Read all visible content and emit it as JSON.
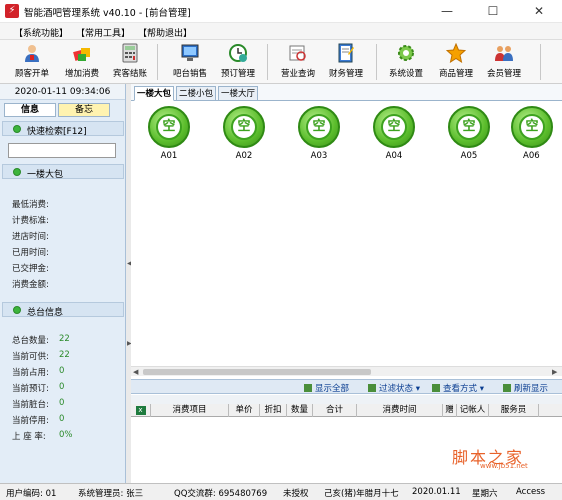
{
  "window": {
    "title": "智能酒吧管理系统 v40.10 - [前台管理]",
    "minimize": "—",
    "maximize": "☐",
    "close": "✕"
  },
  "menu": [
    {
      "label": "【系统功能】"
    },
    {
      "label": "【常用工具】"
    },
    {
      "label": "【帮助退出】"
    }
  ],
  "toolbar": [
    {
      "label": "顾客开单",
      "icon": "customer-icon"
    },
    {
      "label": "增加消费",
      "icon": "add-consume-icon"
    },
    {
      "label": "宾客结账",
      "icon": "calculator-icon"
    },
    {
      "label": "吧台销售",
      "icon": "monitor-icon"
    },
    {
      "label": "预订管理",
      "icon": "clock-icon"
    },
    {
      "label": "营业查询",
      "icon": "magnifier-icon"
    },
    {
      "label": "财务管理",
      "icon": "notebook-icon"
    },
    {
      "label": "系统设置",
      "icon": "gear-icon"
    },
    {
      "label": "商品管理",
      "icon": "star-icon"
    },
    {
      "label": "会员管理",
      "icon": "members-icon"
    }
  ],
  "left": {
    "datetime": "2020-01-11 09:34:06",
    "tabs": [
      "信息",
      "备忘"
    ],
    "search_header": "快速检索[F12]",
    "search_value": "",
    "room_header": "一楼大包",
    "room_fields": [
      "最低消费:",
      "计费标准:",
      "进店时间:",
      "已用时间:",
      "已交押金:",
      "消费金额:"
    ],
    "summary_header": "总台信息",
    "summary": [
      {
        "label": "总台数量:",
        "value": "22"
      },
      {
        "label": "当前可供:",
        "value": "22"
      },
      {
        "label": "当前占用:",
        "value": "0"
      },
      {
        "label": "当前预订:",
        "value": "0"
      },
      {
        "label": "当前脏台:",
        "value": "0"
      },
      {
        "label": "当前停用:",
        "value": "0"
      },
      {
        "label": "上 座 率:",
        "value": "0%"
      }
    ]
  },
  "main": {
    "tabs": [
      "一楼大包",
      "二楼小包",
      "一楼大厅"
    ],
    "status_char": "空",
    "tables": [
      "A01",
      "A02",
      "A03",
      "A04",
      "A05",
      "A06"
    ],
    "actions": [
      {
        "label": "显示全部"
      },
      {
        "label": "过滤状态 ▾"
      },
      {
        "label": "查看方式 ▾"
      },
      {
        "label": "刷新显示"
      }
    ],
    "grid_columns": [
      "",
      "消费项目",
      "单价",
      "折扣",
      "数量",
      "合计",
      "消费时间",
      "赠",
      "记帐人",
      "服务员"
    ]
  },
  "status": {
    "user_code": "用户编码: 01",
    "admin": "系统管理员: 张三",
    "qq": "QQ交流群: 695480769",
    "license": "未授权",
    "lunar": "己亥(猪)年腊月十七",
    "date": "2020.01.11",
    "weekday": "星期六",
    "db": "Access"
  },
  "watermark": {
    "text": "脚本之家",
    "url": "www.jb51.net"
  },
  "colors": {
    "accent_green": "#3da21f",
    "panel_bg": "#e3edf7",
    "link_blue": "#0a3d91",
    "value_green": "#2a8a2a"
  }
}
